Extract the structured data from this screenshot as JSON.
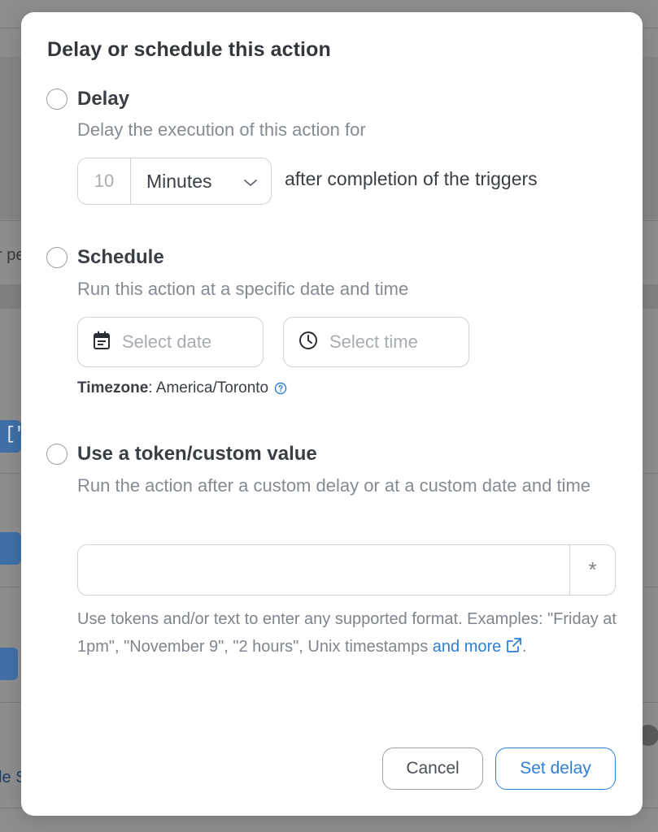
{
  "background": {
    "frag_1": "r pe",
    "frag_2": "[\"",
    "frag_3": "o",
    "frag_4": "le S"
  },
  "modal": {
    "title": "Delay or schedule this action",
    "delay": {
      "label": "Delay",
      "description": "Delay the execution of this action for",
      "amount_placeholder": "10",
      "unit_selected": "Minutes",
      "suffix": "after completion of the triggers"
    },
    "schedule": {
      "label": "Schedule",
      "description": "Run this action at a specific date and time",
      "date_placeholder": "Select date",
      "time_placeholder": "Select time",
      "timezone_label": "Timezone",
      "timezone_value": ": America/Toronto"
    },
    "token": {
      "label": "Use a token/custom value",
      "description": "Run the action after a custom delay or at a custom date and time",
      "input_value": "",
      "token_button": "*",
      "help_text": "Use tokens and/or text to enter any supported format. Examples: \"Friday at 1pm\", \"November 9\", \"2 hours\", Unix timestamps ",
      "help_link": "and more",
      "help_end": "."
    },
    "buttons": {
      "cancel": "Cancel",
      "set_delay": "Set delay"
    }
  },
  "colors": {
    "accent": "#2d7fd3",
    "overlay": "#8d8d8d"
  }
}
